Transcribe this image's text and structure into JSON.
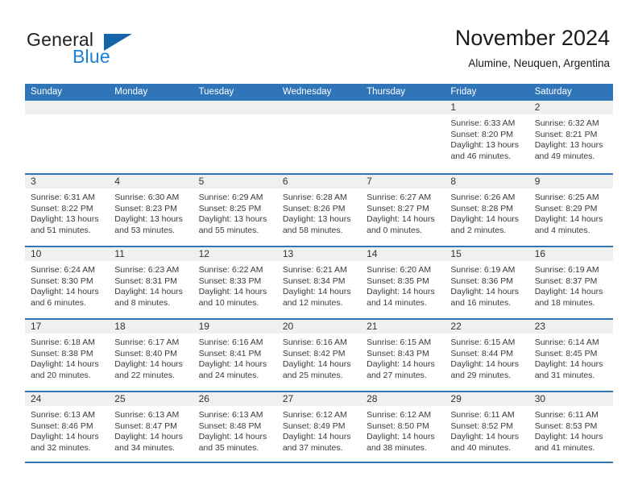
{
  "brand": {
    "name_part1": "General",
    "name_part2": "Blue",
    "flag_icon": "blue-triangle-logo"
  },
  "header": {
    "title": "November 2024",
    "location": "Alumine, Neuquen, Argentina"
  },
  "colors": {
    "header_blue": "#3075b8",
    "brand_blue": "#1b7fd4",
    "day_strip": "#f0f0f0",
    "text": "#3a3a3a"
  },
  "weekdays": [
    "Sunday",
    "Monday",
    "Tuesday",
    "Wednesday",
    "Thursday",
    "Friday",
    "Saturday"
  ],
  "weeks": [
    [
      {
        "day": "",
        "lines": []
      },
      {
        "day": "",
        "lines": []
      },
      {
        "day": "",
        "lines": []
      },
      {
        "day": "",
        "lines": []
      },
      {
        "day": "",
        "lines": []
      },
      {
        "day": "1",
        "lines": [
          "Sunrise: 6:33 AM",
          "Sunset: 8:20 PM",
          "Daylight: 13 hours",
          "and 46 minutes."
        ]
      },
      {
        "day": "2",
        "lines": [
          "Sunrise: 6:32 AM",
          "Sunset: 8:21 PM",
          "Daylight: 13 hours",
          "and 49 minutes."
        ]
      }
    ],
    [
      {
        "day": "3",
        "lines": [
          "Sunrise: 6:31 AM",
          "Sunset: 8:22 PM",
          "Daylight: 13 hours",
          "and 51 minutes."
        ]
      },
      {
        "day": "4",
        "lines": [
          "Sunrise: 6:30 AM",
          "Sunset: 8:23 PM",
          "Daylight: 13 hours",
          "and 53 minutes."
        ]
      },
      {
        "day": "5",
        "lines": [
          "Sunrise: 6:29 AM",
          "Sunset: 8:25 PM",
          "Daylight: 13 hours",
          "and 55 minutes."
        ]
      },
      {
        "day": "6",
        "lines": [
          "Sunrise: 6:28 AM",
          "Sunset: 8:26 PM",
          "Daylight: 13 hours",
          "and 58 minutes."
        ]
      },
      {
        "day": "7",
        "lines": [
          "Sunrise: 6:27 AM",
          "Sunset: 8:27 PM",
          "Daylight: 14 hours",
          "and 0 minutes."
        ]
      },
      {
        "day": "8",
        "lines": [
          "Sunrise: 6:26 AM",
          "Sunset: 8:28 PM",
          "Daylight: 14 hours",
          "and 2 minutes."
        ]
      },
      {
        "day": "9",
        "lines": [
          "Sunrise: 6:25 AM",
          "Sunset: 8:29 PM",
          "Daylight: 14 hours",
          "and 4 minutes."
        ]
      }
    ],
    [
      {
        "day": "10",
        "lines": [
          "Sunrise: 6:24 AM",
          "Sunset: 8:30 PM",
          "Daylight: 14 hours",
          "and 6 minutes."
        ]
      },
      {
        "day": "11",
        "lines": [
          "Sunrise: 6:23 AM",
          "Sunset: 8:31 PM",
          "Daylight: 14 hours",
          "and 8 minutes."
        ]
      },
      {
        "day": "12",
        "lines": [
          "Sunrise: 6:22 AM",
          "Sunset: 8:33 PM",
          "Daylight: 14 hours",
          "and 10 minutes."
        ]
      },
      {
        "day": "13",
        "lines": [
          "Sunrise: 6:21 AM",
          "Sunset: 8:34 PM",
          "Daylight: 14 hours",
          "and 12 minutes."
        ]
      },
      {
        "day": "14",
        "lines": [
          "Sunrise: 6:20 AM",
          "Sunset: 8:35 PM",
          "Daylight: 14 hours",
          "and 14 minutes."
        ]
      },
      {
        "day": "15",
        "lines": [
          "Sunrise: 6:19 AM",
          "Sunset: 8:36 PM",
          "Daylight: 14 hours",
          "and 16 minutes."
        ]
      },
      {
        "day": "16",
        "lines": [
          "Sunrise: 6:19 AM",
          "Sunset: 8:37 PM",
          "Daylight: 14 hours",
          "and 18 minutes."
        ]
      }
    ],
    [
      {
        "day": "17",
        "lines": [
          "Sunrise: 6:18 AM",
          "Sunset: 8:38 PM",
          "Daylight: 14 hours",
          "and 20 minutes."
        ]
      },
      {
        "day": "18",
        "lines": [
          "Sunrise: 6:17 AM",
          "Sunset: 8:40 PM",
          "Daylight: 14 hours",
          "and 22 minutes."
        ]
      },
      {
        "day": "19",
        "lines": [
          "Sunrise: 6:16 AM",
          "Sunset: 8:41 PM",
          "Daylight: 14 hours",
          "and 24 minutes."
        ]
      },
      {
        "day": "20",
        "lines": [
          "Sunrise: 6:16 AM",
          "Sunset: 8:42 PM",
          "Daylight: 14 hours",
          "and 25 minutes."
        ]
      },
      {
        "day": "21",
        "lines": [
          "Sunrise: 6:15 AM",
          "Sunset: 8:43 PM",
          "Daylight: 14 hours",
          "and 27 minutes."
        ]
      },
      {
        "day": "22",
        "lines": [
          "Sunrise: 6:15 AM",
          "Sunset: 8:44 PM",
          "Daylight: 14 hours",
          "and 29 minutes."
        ]
      },
      {
        "day": "23",
        "lines": [
          "Sunrise: 6:14 AM",
          "Sunset: 8:45 PM",
          "Daylight: 14 hours",
          "and 31 minutes."
        ]
      }
    ],
    [
      {
        "day": "24",
        "lines": [
          "Sunrise: 6:13 AM",
          "Sunset: 8:46 PM",
          "Daylight: 14 hours",
          "and 32 minutes."
        ]
      },
      {
        "day": "25",
        "lines": [
          "Sunrise: 6:13 AM",
          "Sunset: 8:47 PM",
          "Daylight: 14 hours",
          "and 34 minutes."
        ]
      },
      {
        "day": "26",
        "lines": [
          "Sunrise: 6:13 AM",
          "Sunset: 8:48 PM",
          "Daylight: 14 hours",
          "and 35 minutes."
        ]
      },
      {
        "day": "27",
        "lines": [
          "Sunrise: 6:12 AM",
          "Sunset: 8:49 PM",
          "Daylight: 14 hours",
          "and 37 minutes."
        ]
      },
      {
        "day": "28",
        "lines": [
          "Sunrise: 6:12 AM",
          "Sunset: 8:50 PM",
          "Daylight: 14 hours",
          "and 38 minutes."
        ]
      },
      {
        "day": "29",
        "lines": [
          "Sunrise: 6:11 AM",
          "Sunset: 8:52 PM",
          "Daylight: 14 hours",
          "and 40 minutes."
        ]
      },
      {
        "day": "30",
        "lines": [
          "Sunrise: 6:11 AM",
          "Sunset: 8:53 PM",
          "Daylight: 14 hours",
          "and 41 minutes."
        ]
      }
    ]
  ]
}
